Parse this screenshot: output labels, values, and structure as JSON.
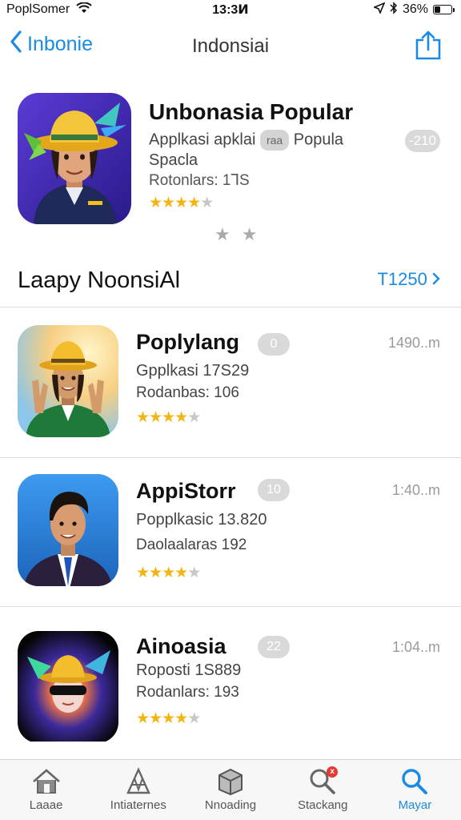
{
  "status_bar": {
    "carrier": "PoplSomer",
    "time": "13:3Ͷ",
    "battery": "36%",
    "battery_level": 0.36,
    "icons": [
      "wifi-icon",
      "location-icon",
      "bluetooth-icon",
      "battery-icon"
    ]
  },
  "nav": {
    "back_label": "Inbonie",
    "title": "Indonsiai",
    "icons": [
      "chevron-left-icon",
      "share-icon"
    ]
  },
  "featured": {
    "title": "Unbonasia Popular",
    "subtitle_before": "Applkasi apklai",
    "subtitle_pill": "raa",
    "subtitle_after": "Popula Spacla",
    "ratings": "Rotonlars: 1⅂S",
    "stars": 4,
    "price": "-210",
    "dots": "★★"
  },
  "section": {
    "title": "Laapy NoonsiAl",
    "see_all": "T1250"
  },
  "apps": [
    {
      "title": "Poplylang",
      "subtitle": "Gpplkasi 17S29",
      "ratings": "Rodanbas: 106",
      "stars": 4,
      "price": "0",
      "time": "1490..m"
    },
    {
      "title": "AppiStorr",
      "subtitle": "Popplkasic 13.820",
      "ratings": "Daolaalaras 192",
      "stars": 4,
      "price": "10",
      "time": "1:40..m"
    },
    {
      "title": "Ainoasia",
      "subtitle": "Roposti 1S889",
      "ratings": "Rodanlars: 193",
      "stars": 4,
      "price": "22",
      "time": "1:04..m"
    }
  ],
  "tabs": [
    {
      "label": "Laaae",
      "icon": "home-icon",
      "active": false,
      "badge": ""
    },
    {
      "label": "Intiaternes",
      "icon": "apps-icon",
      "active": false,
      "badge": ""
    },
    {
      "label": "Nnoading",
      "icon": "box-icon",
      "active": false,
      "badge": ""
    },
    {
      "label": "Stackang",
      "icon": "search-badge-icon",
      "active": false,
      "badge": "x"
    },
    {
      "label": "Mayar",
      "icon": "search-icon",
      "active": true,
      "badge": ""
    }
  ],
  "colors": {
    "accent": "#1b8ae3",
    "star": "#f3b414",
    "pill": "#d9d9d9"
  }
}
